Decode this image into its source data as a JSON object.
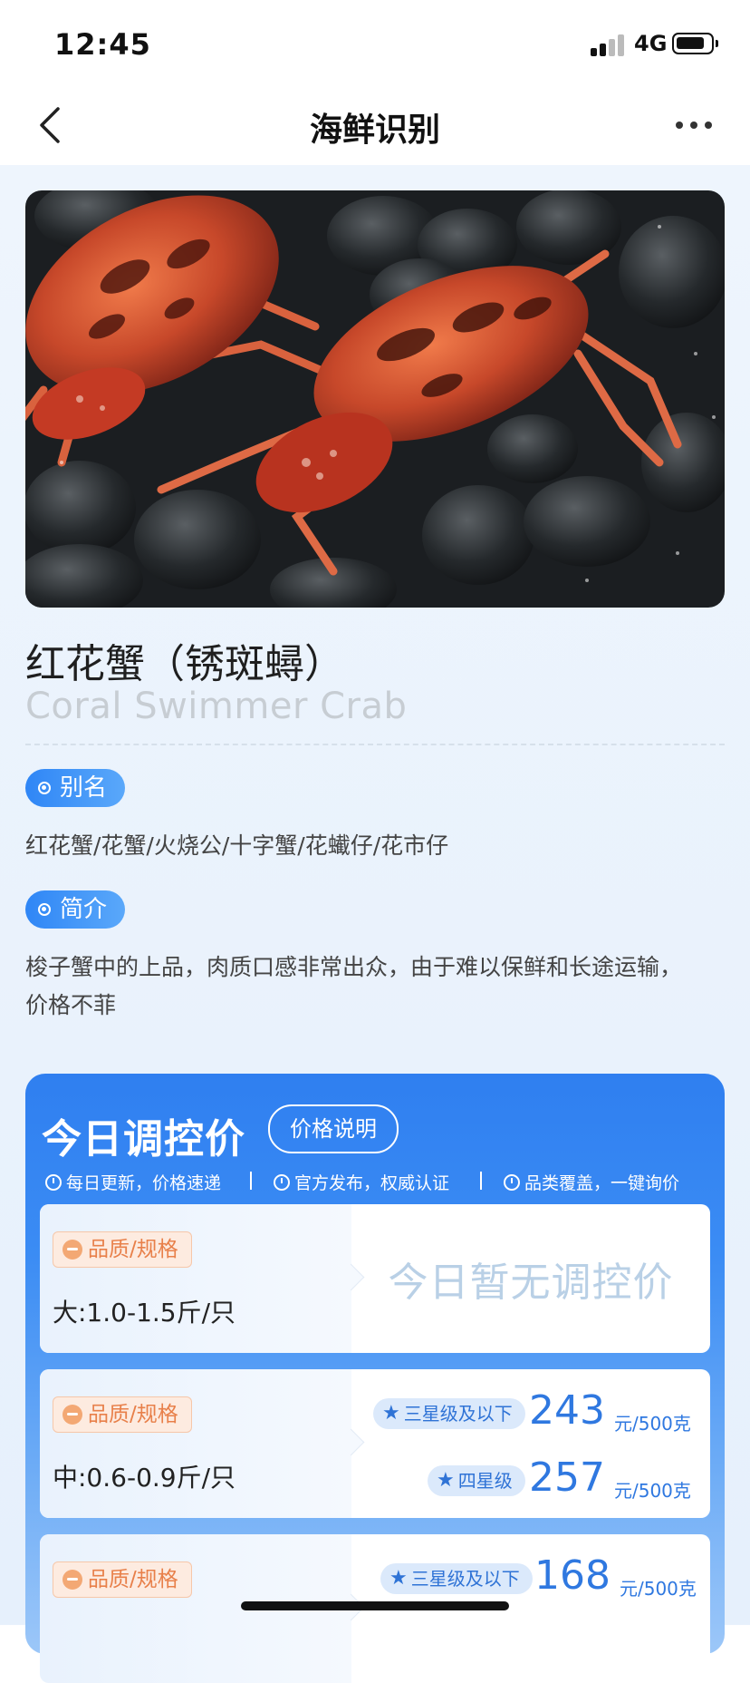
{
  "status_bar": {
    "time": "12:45",
    "network": "4G"
  },
  "nav": {
    "title": "海鲜识别"
  },
  "species": {
    "name": "红花蟹（锈斑蟳）",
    "english_name": "Coral Swimmer Crab"
  },
  "alias": {
    "label": "别名",
    "text": "红花蟹/花蟹/火烧公/十字蟹/花蠘仔/花市仔"
  },
  "intro": {
    "label": "简介",
    "text_line1": "梭子蟹中的上品，肉质口感非常出众，由于难以保鲜和长途运输，",
    "text_line2": "价格不菲"
  },
  "price_section": {
    "title": "今日调控价",
    "explain_button": "价格说明",
    "features": [
      "每日更新，价格速递",
      "官方发布，权威认证",
      "品类覆盖，一键询价"
    ],
    "tag_label": "品质/规格",
    "no_price_text": "今日暂无调控价",
    "rows": [
      {
        "spec": "大:1.0-1.5斤/只"
      },
      {
        "spec": "中:0.6-0.9斤/只",
        "grades": [
          {
            "label": "三星级及以下",
            "price": "243",
            "unit": "元/500克"
          },
          {
            "label": "四星级",
            "price": "257",
            "unit": "元/500克"
          }
        ]
      },
      {
        "grades": [
          {
            "label": "三星级及以下",
            "price": "168",
            "unit": "元/500克"
          }
        ]
      }
    ]
  },
  "colors": {
    "accent": "#2f86f6",
    "price_blue": "#2f78e0",
    "tag_orange": "#e8804a"
  }
}
